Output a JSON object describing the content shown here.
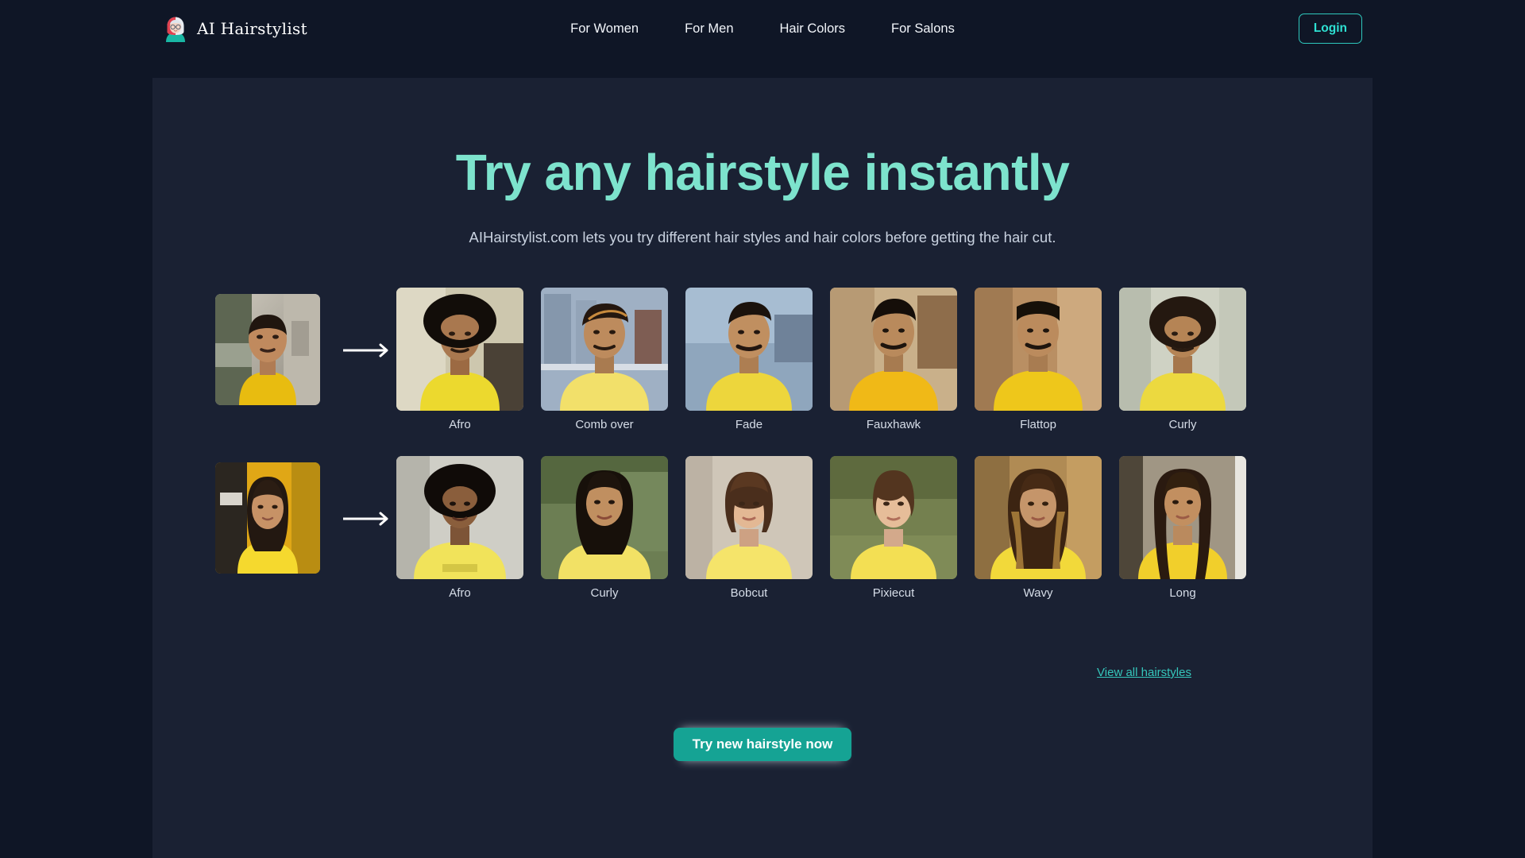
{
  "brand": {
    "name": "AI Hairstylist",
    "logo_icon": "avatar-hairstylist-icon"
  },
  "nav": {
    "items": [
      {
        "label": "For Women"
      },
      {
        "label": "For Men"
      },
      {
        "label": "Hair Colors"
      },
      {
        "label": "For Salons"
      }
    ],
    "login_label": "Login"
  },
  "hero": {
    "title": "Try any hairstyle instantly",
    "subtitle": "AIHairstylist.com lets you try different hair styles and hair colors before getting the hair cut."
  },
  "rows": [
    {
      "source_alt": "man-in-yellow-tshirt-photo",
      "arrow_icon": "arrow-right-icon",
      "cards": [
        {
          "label": "Afro"
        },
        {
          "label": "Comb over"
        },
        {
          "label": "Fade"
        },
        {
          "label": "Fauxhawk"
        },
        {
          "label": "Flattop"
        },
        {
          "label": "Curly"
        }
      ]
    },
    {
      "source_alt": "woman-in-yellow-tshirt-photo",
      "arrow_icon": "arrow-right-icon",
      "cards": [
        {
          "label": "Afro"
        },
        {
          "label": "Curly"
        },
        {
          "label": "Bobcut"
        },
        {
          "label": "Pixiecut"
        },
        {
          "label": "Wavy"
        },
        {
          "label": "Long"
        }
      ]
    }
  ],
  "footer": {
    "view_all_label": "View all hairstyles",
    "cta_label": "Try new hairstyle now"
  },
  "colors": {
    "page_bg": "#0f1626",
    "panel_bg": "#1a2133",
    "accent_teal": "#2ee0d2",
    "heading_mint": "#7de3cd",
    "cta_green": "#15a394",
    "link_teal": "#35c6bb"
  }
}
